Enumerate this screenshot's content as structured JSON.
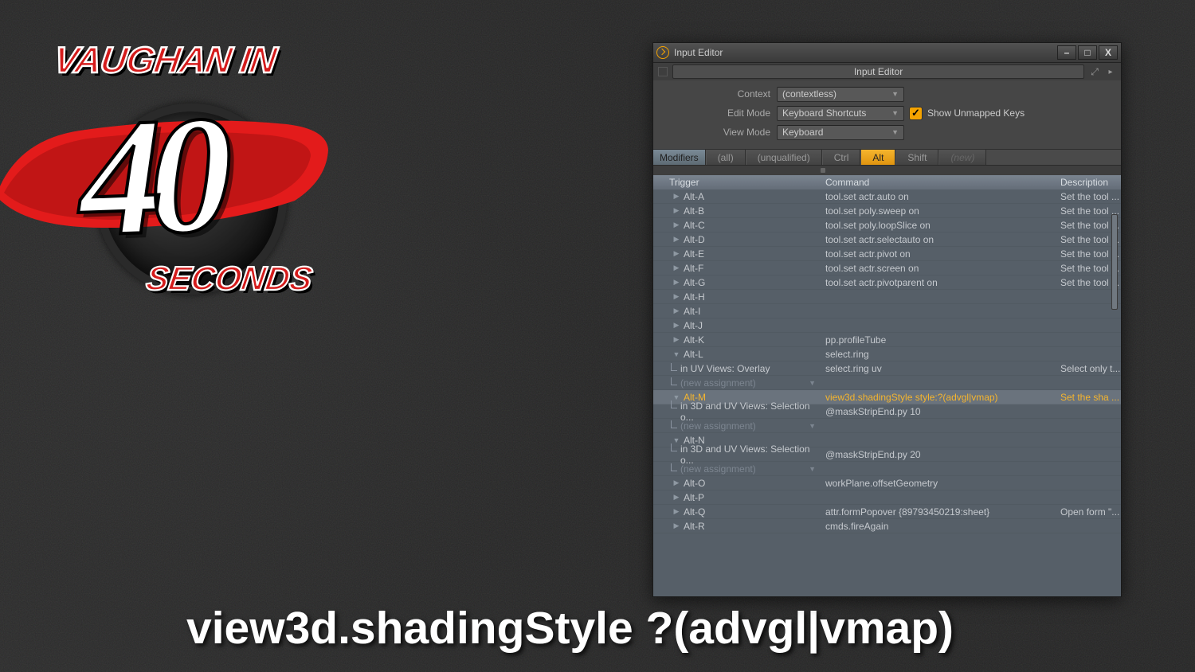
{
  "logo": {
    "top": "VAUGHAN IN",
    "number": "40",
    "bottom": "SECONDS"
  },
  "caption": "view3d.shadingStyle ?(advgl|vmap)",
  "window": {
    "title": "Input Editor",
    "tab": "Input Editor",
    "form": {
      "context_label": "Context",
      "context_value": "(contextless)",
      "editmode_label": "Edit Mode",
      "editmode_value": "Keyboard Shortcuts",
      "show_unmapped_label": "Show Unmapped Keys",
      "viewmode_label": "View Mode",
      "viewmode_value": "Keyboard"
    },
    "modifiers": {
      "label": "Modifiers",
      "buttons": [
        "(all)",
        "(unqualified)",
        "Ctrl",
        "Alt",
        "Shift",
        "(new)"
      ],
      "active": "Alt"
    },
    "columns": {
      "trigger": "Trigger",
      "command": "Command",
      "desc": "Description"
    },
    "rows": [
      {
        "type": "parent",
        "trigger": "Alt-A",
        "command": "tool.set actr.auto on",
        "desc": "Set the tool ..."
      },
      {
        "type": "parent",
        "trigger": "Alt-B",
        "command": "tool.set poly.sweep on",
        "desc": "Set the tool ..."
      },
      {
        "type": "parent",
        "trigger": "Alt-C",
        "command": "tool.set poly.loopSlice on",
        "desc": "Set the tool ..."
      },
      {
        "type": "parent",
        "trigger": "Alt-D",
        "command": "tool.set actr.selectauto on",
        "desc": "Set the tool ..."
      },
      {
        "type": "parent",
        "trigger": "Alt-E",
        "command": "tool.set actr.pivot on",
        "desc": "Set the tool ..."
      },
      {
        "type": "parent",
        "trigger": "Alt-F",
        "command": "tool.set actr.screen on",
        "desc": "Set the tool ..."
      },
      {
        "type": "parent",
        "trigger": "Alt-G",
        "command": "tool.set actr.pivotparent on",
        "desc": "Set the tool ..."
      },
      {
        "type": "parent",
        "trigger": "Alt-H",
        "command": "",
        "desc": ""
      },
      {
        "type": "parent",
        "trigger": "Alt-I",
        "command": "",
        "desc": ""
      },
      {
        "type": "parent",
        "trigger": "Alt-J",
        "command": "",
        "desc": ""
      },
      {
        "type": "parent",
        "trigger": "Alt-K",
        "command": "pp.profileTube",
        "desc": ""
      },
      {
        "type": "parent-open",
        "trigger": "Alt-L",
        "command": "select.ring",
        "desc": ""
      },
      {
        "type": "child",
        "trigger": "in UV Views: Overlay",
        "command": "select.ring uv",
        "desc": "Select only t..."
      },
      {
        "type": "child-new",
        "trigger": "(new assignment)",
        "command": "",
        "desc": ""
      },
      {
        "type": "parent-open",
        "selected": true,
        "trigger": "Alt-M",
        "command": "view3d.shadingStyle style:?(advgl|vmap)",
        "desc": "Set the sha ..."
      },
      {
        "type": "child",
        "trigger": "in 3D and UV Views: Selection o...",
        "command": "@maskStripEnd.py 10",
        "desc": ""
      },
      {
        "type": "child-new",
        "trigger": "(new assignment)",
        "command": "",
        "desc": ""
      },
      {
        "type": "parent-open",
        "trigger": "Alt-N",
        "command": "",
        "desc": ""
      },
      {
        "type": "child",
        "trigger": "in 3D and UV Views: Selection o...",
        "command": "@maskStripEnd.py 20",
        "desc": ""
      },
      {
        "type": "child-new",
        "trigger": "(new assignment)",
        "command": "",
        "desc": ""
      },
      {
        "type": "parent",
        "trigger": "Alt-O",
        "command": "workPlane.offsetGeometry",
        "desc": ""
      },
      {
        "type": "parent",
        "trigger": "Alt-P",
        "command": "",
        "desc": ""
      },
      {
        "type": "parent",
        "trigger": "Alt-Q",
        "command": "attr.formPopover {89793450219:sheet}",
        "desc": "Open form \"..."
      },
      {
        "type": "parent",
        "trigger": "Alt-R",
        "command": "cmds.fireAgain",
        "desc": ""
      }
    ]
  }
}
